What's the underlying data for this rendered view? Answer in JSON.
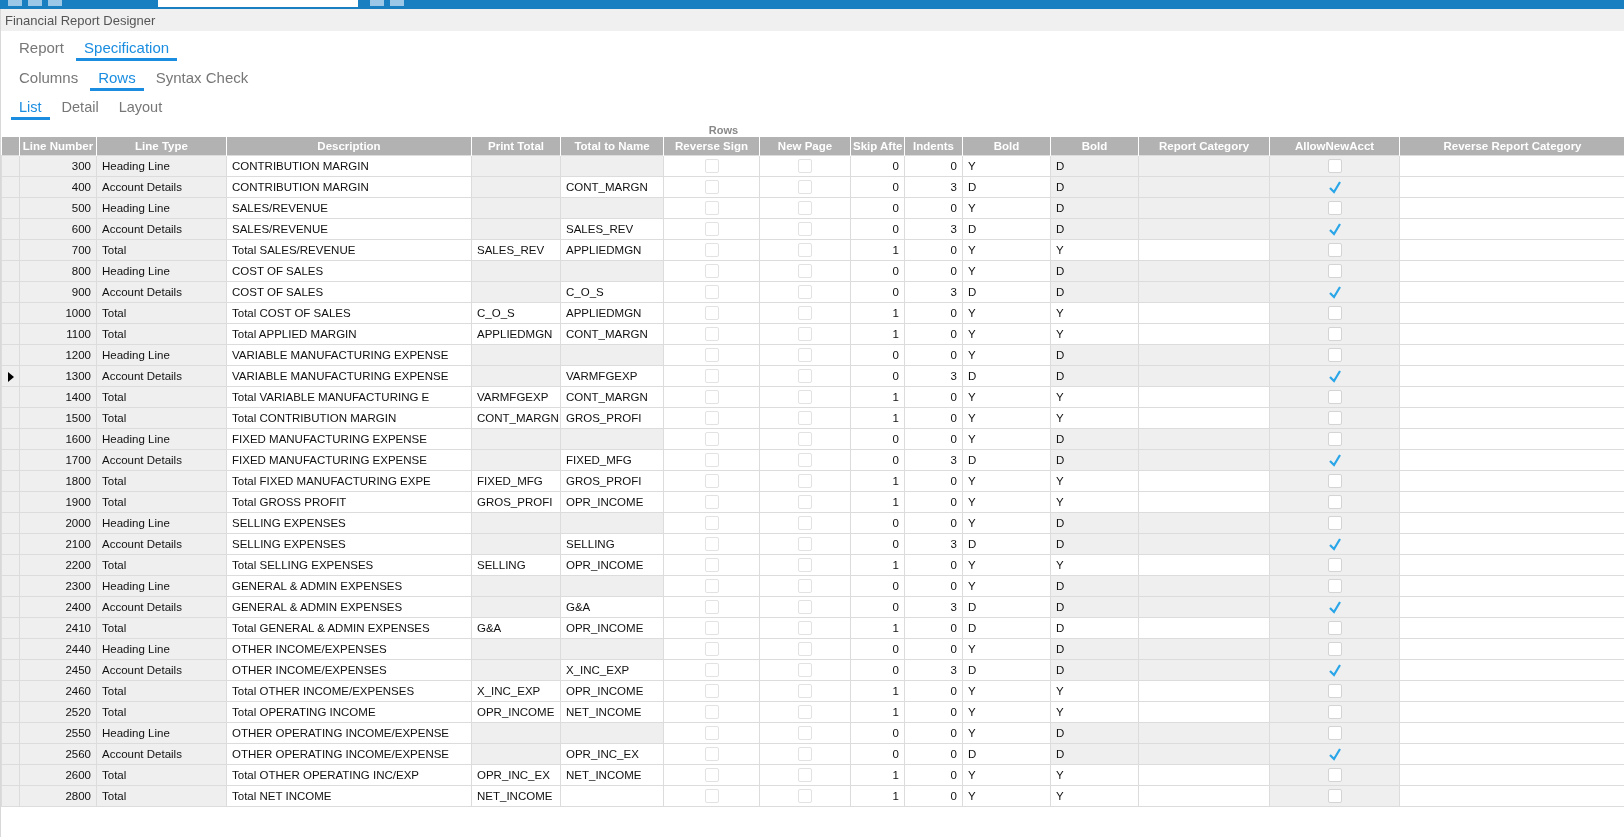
{
  "window": {
    "title": "Financial Report Designer"
  },
  "tabs": [
    {
      "label": "Report",
      "selected": false
    },
    {
      "label": "Specification",
      "selected": true
    }
  ],
  "sub_tabs": [
    {
      "label": "Columns",
      "selected": false
    },
    {
      "label": "Rows",
      "selected": true
    },
    {
      "label": "Syntax Check",
      "selected": false
    }
  ],
  "view_tabs": [
    {
      "label": "List",
      "selected": true
    },
    {
      "label": "Detail",
      "selected": false
    },
    {
      "label": "Layout",
      "selected": false
    }
  ],
  "table": {
    "caption": "Rows",
    "columns": [
      "Line Number",
      "Line Type",
      "Description",
      "Print Total",
      "Total to Name",
      "Reverse Sign",
      "New Page",
      "Skip Afte",
      "Indents",
      "Bold",
      "Bold",
      "Report Category",
      "AllowNewAcct",
      "Reverse Report Category"
    ],
    "rows": [
      {
        "line_number": "300",
        "line_type": "Heading Line",
        "kind": "heading",
        "description": "CONTRIBUTION MARGIN",
        "reverse_sign": false,
        "new_page": false,
        "skip_after": "0",
        "indents": "0",
        "bold": "Y",
        "bold_2": "D",
        "allow_new_acct": false,
        "selected": false
      },
      {
        "line_number": "400",
        "line_type": "Account Details",
        "kind": "account",
        "description": "CONTRIBUTION MARGIN",
        "total_to_name": "CONT_MARGN",
        "reverse_sign": false,
        "new_page": false,
        "skip_after": "0",
        "indents": "3",
        "bold": "D",
        "bold_2": "D",
        "allow_new_acct": true,
        "selected": false
      },
      {
        "line_number": "500",
        "line_type": "Heading Line",
        "kind": "heading",
        "description": "SALES/REVENUE",
        "reverse_sign": false,
        "new_page": false,
        "skip_after": "0",
        "indents": "0",
        "bold": "Y",
        "bold_2": "D",
        "allow_new_acct": false,
        "selected": false
      },
      {
        "line_number": "600",
        "line_type": "Account Details",
        "kind": "account",
        "description": "SALES/REVENUE",
        "total_to_name": "SALES_REV",
        "reverse_sign": false,
        "new_page": false,
        "skip_after": "0",
        "indents": "3",
        "bold": "D",
        "bold_2": "D",
        "allow_new_acct": true,
        "selected": false
      },
      {
        "line_number": "700",
        "line_type": "Total",
        "kind": "total",
        "description": "Total SALES/REVENUE",
        "print_total": "SALES_REV",
        "total_to_name": "APPLIEDMGN",
        "reverse_sign": false,
        "new_page": false,
        "skip_after": "1",
        "indents": "0",
        "bold": "Y",
        "bold_2": "Y",
        "allow_new_acct": false,
        "selected": false
      },
      {
        "line_number": "800",
        "line_type": "Heading Line",
        "kind": "heading",
        "description": "COST OF SALES",
        "reverse_sign": false,
        "new_page": false,
        "skip_after": "0",
        "indents": "0",
        "bold": "Y",
        "bold_2": "D",
        "allow_new_acct": false,
        "selected": false
      },
      {
        "line_number": "900",
        "line_type": "Account Details",
        "kind": "account",
        "description": "COST OF SALES",
        "total_to_name": "C_O_S",
        "reverse_sign": false,
        "new_page": false,
        "skip_after": "0",
        "indents": "3",
        "bold": "D",
        "bold_2": "D",
        "allow_new_acct": true,
        "selected": false
      },
      {
        "line_number": "1000",
        "line_type": "Total",
        "kind": "total",
        "description": "Total COST OF SALES",
        "print_total": "C_O_S",
        "total_to_name": "APPLIEDMGN",
        "reverse_sign": false,
        "new_page": false,
        "skip_after": "1",
        "indents": "0",
        "bold": "Y",
        "bold_2": "Y",
        "allow_new_acct": false,
        "selected": false
      },
      {
        "line_number": "1100",
        "line_type": "Total",
        "kind": "total",
        "description": "Total APPLIED MARGIN",
        "print_total": "APPLIEDMGN",
        "total_to_name": "CONT_MARGN",
        "reverse_sign": false,
        "new_page": false,
        "skip_after": "1",
        "indents": "0",
        "bold": "Y",
        "bold_2": "Y",
        "allow_new_acct": false,
        "selected": false
      },
      {
        "line_number": "1200",
        "line_type": "Heading Line",
        "kind": "heading",
        "description": "VARIABLE MANUFACTURING EXPENSE",
        "reverse_sign": false,
        "new_page": false,
        "skip_after": "0",
        "indents": "0",
        "bold": "Y",
        "bold_2": "D",
        "allow_new_acct": false,
        "selected": false
      },
      {
        "line_number": "1300",
        "line_type": "Account Details",
        "kind": "account",
        "description": "VARIABLE MANUFACTURING EXPENSE",
        "total_to_name": "VARMFGEXP",
        "reverse_sign": false,
        "new_page": false,
        "skip_after": "0",
        "indents": "3",
        "bold": "D",
        "bold_2": "D",
        "allow_new_acct": true,
        "selected": true
      },
      {
        "line_number": "1400",
        "line_type": "Total",
        "kind": "total",
        "description": "Total VARIABLE MANUFACTURING E",
        "print_total": "VARMFGEXP",
        "total_to_name": "CONT_MARGN",
        "reverse_sign": false,
        "new_page": false,
        "skip_after": "1",
        "indents": "0",
        "bold": "Y",
        "bold_2": "Y",
        "allow_new_acct": false,
        "selected": false
      },
      {
        "line_number": "1500",
        "line_type": "Total",
        "kind": "total",
        "description": "Total CONTRIBUTION MARGIN",
        "print_total": "CONT_MARGN",
        "total_to_name": "GROS_PROFI",
        "reverse_sign": false,
        "new_page": false,
        "skip_after": "1",
        "indents": "0",
        "bold": "Y",
        "bold_2": "Y",
        "allow_new_acct": false,
        "selected": false
      },
      {
        "line_number": "1600",
        "line_type": "Heading Line",
        "kind": "heading",
        "description": "FIXED MANUFACTURING EXPENSE",
        "reverse_sign": false,
        "new_page": false,
        "skip_after": "0",
        "indents": "0",
        "bold": "Y",
        "bold_2": "D",
        "allow_new_acct": false,
        "selected": false
      },
      {
        "line_number": "1700",
        "line_type": "Account Details",
        "kind": "account",
        "description": "FIXED MANUFACTURING EXPENSE",
        "total_to_name": "FIXED_MFG",
        "reverse_sign": false,
        "new_page": false,
        "skip_after": "0",
        "indents": "3",
        "bold": "D",
        "bold_2": "D",
        "allow_new_acct": true,
        "selected": false
      },
      {
        "line_number": "1800",
        "line_type": "Total",
        "kind": "total",
        "description": "Total FIXED MANUFACTURING EXPE",
        "print_total": "FIXED_MFG",
        "total_to_name": "GROS_PROFI",
        "reverse_sign": false,
        "new_page": false,
        "skip_after": "1",
        "indents": "0",
        "bold": "Y",
        "bold_2": "Y",
        "allow_new_acct": false,
        "selected": false
      },
      {
        "line_number": "1900",
        "line_type": "Total",
        "kind": "total",
        "description": "Total GROSS PROFIT",
        "print_total": "GROS_PROFI",
        "total_to_name": "OPR_INCOME",
        "reverse_sign": false,
        "new_page": false,
        "skip_after": "1",
        "indents": "0",
        "bold": "Y",
        "bold_2": "Y",
        "allow_new_acct": false,
        "selected": false
      },
      {
        "line_number": "2000",
        "line_type": "Heading Line",
        "kind": "heading",
        "description": "SELLING EXPENSES",
        "reverse_sign": false,
        "new_page": false,
        "skip_after": "0",
        "indents": "0",
        "bold": "Y",
        "bold_2": "D",
        "allow_new_acct": false,
        "selected": false
      },
      {
        "line_number": "2100",
        "line_type": "Account Details",
        "kind": "account",
        "description": "SELLING EXPENSES",
        "total_to_name": "SELLING",
        "reverse_sign": false,
        "new_page": false,
        "skip_after": "0",
        "indents": "3",
        "bold": "D",
        "bold_2": "D",
        "allow_new_acct": true,
        "selected": false
      },
      {
        "line_number": "2200",
        "line_type": "Total",
        "kind": "total",
        "description": "Total SELLING EXPENSES",
        "print_total": "SELLING",
        "total_to_name": "OPR_INCOME",
        "reverse_sign": false,
        "new_page": false,
        "skip_after": "1",
        "indents": "0",
        "bold": "Y",
        "bold_2": "Y",
        "allow_new_acct": false,
        "selected": false
      },
      {
        "line_number": "2300",
        "line_type": "Heading Line",
        "kind": "heading",
        "description": "GENERAL & ADMIN EXPENSES",
        "reverse_sign": false,
        "new_page": false,
        "skip_after": "0",
        "indents": "0",
        "bold": "Y",
        "bold_2": "D",
        "allow_new_acct": false,
        "selected": false
      },
      {
        "line_number": "2400",
        "line_type": "Account Details",
        "kind": "account",
        "description": "GENERAL & ADMIN EXPENSES",
        "total_to_name": "G&A",
        "reverse_sign": false,
        "new_page": false,
        "skip_after": "0",
        "indents": "3",
        "bold": "D",
        "bold_2": "D",
        "allow_new_acct": true,
        "selected": false
      },
      {
        "line_number": "2410",
        "line_type": "Total",
        "kind": "total",
        "description": "Total GENERAL & ADMIN EXPENSES",
        "print_total": "G&A",
        "total_to_name": "OPR_INCOME",
        "reverse_sign": false,
        "new_page": false,
        "skip_after": "1",
        "indents": "0",
        "bold": "D",
        "bold_2": "D",
        "allow_new_acct": false,
        "selected": false
      },
      {
        "line_number": "2440",
        "line_type": "Heading Line",
        "kind": "heading",
        "description": "OTHER INCOME/EXPENSES",
        "reverse_sign": false,
        "new_page": false,
        "skip_after": "0",
        "indents": "0",
        "bold": "Y",
        "bold_2": "D",
        "allow_new_acct": false,
        "selected": false
      },
      {
        "line_number": "2450",
        "line_type": "Account Details",
        "kind": "account",
        "description": "OTHER INCOME/EXPENSES",
        "total_to_name": "X_INC_EXP",
        "reverse_sign": false,
        "new_page": false,
        "skip_after": "0",
        "indents": "3",
        "bold": "D",
        "bold_2": "D",
        "allow_new_acct": true,
        "selected": false
      },
      {
        "line_number": "2460",
        "line_type": "Total",
        "kind": "total",
        "description": "Total OTHER INCOME/EXPENSES",
        "print_total": "X_INC_EXP",
        "total_to_name": "OPR_INCOME",
        "reverse_sign": false,
        "new_page": false,
        "skip_after": "1",
        "indents": "0",
        "bold": "Y",
        "bold_2": "Y",
        "allow_new_acct": false,
        "selected": false
      },
      {
        "line_number": "2520",
        "line_type": "Total",
        "kind": "total",
        "description": "Total OPERATING INCOME",
        "print_total": "OPR_INCOME",
        "total_to_name": "NET_INCOME",
        "reverse_sign": false,
        "new_page": false,
        "skip_after": "1",
        "indents": "0",
        "bold": "Y",
        "bold_2": "Y",
        "allow_new_acct": false,
        "selected": false
      },
      {
        "line_number": "2550",
        "line_type": "Heading Line",
        "kind": "heading",
        "description": "OTHER OPERATING INCOME/EXPENSE",
        "reverse_sign": false,
        "new_page": false,
        "skip_after": "0",
        "indents": "0",
        "bold": "Y",
        "bold_2": "D",
        "allow_new_acct": false,
        "selected": false
      },
      {
        "line_number": "2560",
        "line_type": "Account Details",
        "kind": "account",
        "description": "OTHER OPERATING INCOME/EXPENSE",
        "total_to_name": "OPR_INC_EX",
        "reverse_sign": false,
        "new_page": false,
        "skip_after": "0",
        "indents": "0",
        "bold": "D",
        "bold_2": "D",
        "allow_new_acct": true,
        "selected": false
      },
      {
        "line_number": "2600",
        "line_type": "Total",
        "kind": "total",
        "description": "Total OTHER OPERATING INC/EXP",
        "print_total": "OPR_INC_EX",
        "total_to_name": "NET_INCOME",
        "reverse_sign": false,
        "new_page": false,
        "skip_after": "1",
        "indents": "0",
        "bold": "Y",
        "bold_2": "Y",
        "allow_new_acct": false,
        "selected": false
      },
      {
        "line_number": "2800",
        "line_type": "Total",
        "kind": "total",
        "description": "Total NET INCOME",
        "print_total": "NET_INCOME",
        "reverse_sign": false,
        "new_page": false,
        "skip_after": "1",
        "indents": "0",
        "bold": "Y",
        "bold_2": "Y",
        "allow_new_acct": false,
        "selected": false
      }
    ]
  }
}
